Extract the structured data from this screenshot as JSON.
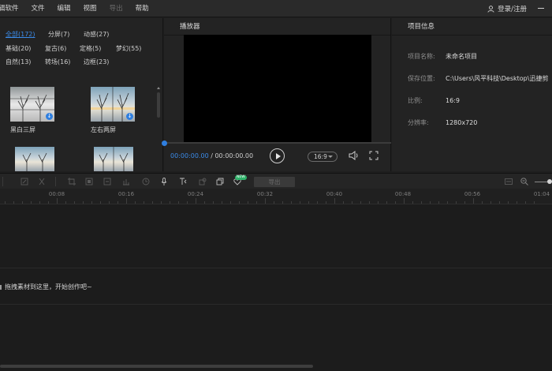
{
  "menubar": {
    "items": [
      {
        "label": "辑软件",
        "disabled": false
      },
      {
        "label": "文件",
        "disabled": false
      },
      {
        "label": "编辑",
        "disabled": false
      },
      {
        "label": "视图",
        "disabled": false
      },
      {
        "label": "导出",
        "disabled": true
      },
      {
        "label": "帮助",
        "disabled": false
      }
    ],
    "login_label": "登录/注册"
  },
  "media": {
    "categories": [
      {
        "label": "全部(172)",
        "active": true
      },
      {
        "label": "分屏(7)"
      },
      {
        "label": "动感(27)"
      },
      {
        "label": "基础(20)"
      },
      {
        "label": "复古(6)"
      },
      {
        "label": "定格(5)"
      },
      {
        "label": "梦幻(55)"
      },
      {
        "label": "自然(13)"
      },
      {
        "label": "转场(16)"
      },
      {
        "label": "边框(23)"
      }
    ],
    "items": [
      {
        "label": "黑白三屏"
      },
      {
        "label": "左右两屏"
      },
      {
        "label": ""
      },
      {
        "label": ""
      }
    ],
    "download_glyph": "↓"
  },
  "player": {
    "title": "播放器",
    "current_time": "00:00:00.00",
    "separator": " / ",
    "total_time": "00:00:00.00",
    "ratio": "16:9"
  },
  "info": {
    "title": "项目信息",
    "rows": [
      {
        "key": "项目名称:",
        "value": "未命名项目"
      },
      {
        "key": "保存位置:",
        "value": "C:\\Users\\风平科技\\Desktop\\迅捷剪"
      },
      {
        "key": "比例:",
        "value": "16:9"
      },
      {
        "key": "分辨率:",
        "value": "1280x720"
      }
    ]
  },
  "toolbar": {
    "new_badge": "NEW",
    "export_label": "导出"
  },
  "ruler": {
    "labels": [
      "00:08",
      "00:16",
      "00:24",
      "00:32",
      "00:40",
      "00:48",
      "00:56",
      "01:04"
    ]
  },
  "timeline": {
    "drop_hint": "拖拽素材到这里，开始创作吧~"
  }
}
